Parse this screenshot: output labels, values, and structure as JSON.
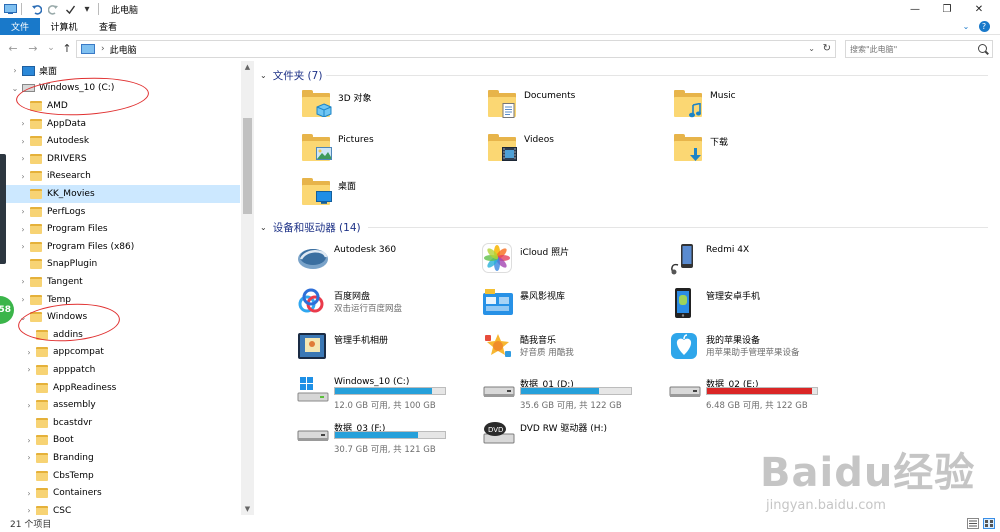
{
  "window": {
    "title": "此电脑",
    "quick_access_down": "▾",
    "minimize": "—",
    "maximize": "❐",
    "close": "✕"
  },
  "ribbon": {
    "tabs": [
      "文件",
      "计算机",
      "查看"
    ],
    "help_icon": "?"
  },
  "nav": {
    "back": "←",
    "forward": "→",
    "recent": "⌄",
    "up": "↑",
    "address": "此电脑",
    "address_chevron": "›",
    "search_placeholder": "搜索\"此电脑\""
  },
  "tree": [
    {
      "label": "桌面",
      "level": 0,
      "expander": "›",
      "icon": "desktop-icon"
    },
    {
      "label": "Windows_10 (C:)",
      "level": 0,
      "expander": "⌄",
      "icon": "drive-icon"
    },
    {
      "label": "AMD",
      "level": 1,
      "expander": ""
    },
    {
      "label": "AppData",
      "level": 1,
      "expander": "›"
    },
    {
      "label": "Autodesk",
      "level": 1,
      "expander": "›"
    },
    {
      "label": "DRIVERS",
      "level": 1,
      "expander": "›"
    },
    {
      "label": "iResearch",
      "level": 1,
      "expander": "›"
    },
    {
      "label": "KK_Movies",
      "level": 1,
      "expander": "",
      "selected": true
    },
    {
      "label": "PerfLogs",
      "level": 1,
      "expander": "›"
    },
    {
      "label": "Program Files",
      "level": 1,
      "expander": "›"
    },
    {
      "label": "Program Files (x86)",
      "level": 1,
      "expander": "›"
    },
    {
      "label": "SnapPlugin",
      "level": 1,
      "expander": ""
    },
    {
      "label": "Tangent",
      "level": 1,
      "expander": "›"
    },
    {
      "label": "Temp",
      "level": 1,
      "expander": "›"
    },
    {
      "label": "Windows",
      "level": 1,
      "expander": "⌄"
    },
    {
      "label": "addins",
      "level": 2,
      "expander": ""
    },
    {
      "label": "appcompat",
      "level": 2,
      "expander": "›"
    },
    {
      "label": "apppatch",
      "level": 2,
      "expander": "›"
    },
    {
      "label": "AppReadiness",
      "level": 2,
      "expander": ""
    },
    {
      "label": "assembly",
      "level": 2,
      "expander": "›"
    },
    {
      "label": "bcastdvr",
      "level": 2,
      "expander": ""
    },
    {
      "label": "Boot",
      "level": 2,
      "expander": "›"
    },
    {
      "label": "Branding",
      "level": 2,
      "expander": "›"
    },
    {
      "label": "CbsTemp",
      "level": 2,
      "expander": ""
    },
    {
      "label": "Containers",
      "level": 2,
      "expander": "›"
    },
    {
      "label": "CSC",
      "level": 2,
      "expander": "›"
    }
  ],
  "groups": {
    "folders_header": "文件夹 (7)",
    "devices_header": "设备和驱动器 (14)",
    "chevron": "⌄"
  },
  "folders": [
    {
      "name": "3D 对象",
      "icon": "3d-objects-icon"
    },
    {
      "name": "Documents",
      "icon": "documents-icon"
    },
    {
      "name": "Music",
      "icon": "music-icon"
    },
    {
      "name": "Pictures",
      "icon": "pictures-icon"
    },
    {
      "name": "Videos",
      "icon": "videos-icon"
    },
    {
      "name": "下载",
      "icon": "downloads-icon"
    },
    {
      "name": "桌面",
      "icon": "desktop-folder-icon"
    }
  ],
  "devices": [
    {
      "name": "Autodesk 360",
      "sub": "",
      "icon": "autodesk360-icon"
    },
    {
      "name": "iCloud 照片",
      "sub": "",
      "icon": "icloud-photos-icon"
    },
    {
      "name": "Redmi 4X",
      "sub": "",
      "icon": "phone-icon"
    },
    {
      "name": "百度网盘",
      "sub": "双击运行百度网盘",
      "icon": "baidu-netdisk-icon"
    },
    {
      "name": "暴风影视库",
      "sub": "",
      "icon": "baofeng-icon"
    },
    {
      "name": "管理安卓手机",
      "sub": "",
      "icon": "android-manager-icon"
    },
    {
      "name": "管理手机相册",
      "sub": "",
      "icon": "phone-album-icon"
    },
    {
      "name": "酷我音乐",
      "sub": "好音质 用酷我",
      "icon": "kuwo-icon"
    },
    {
      "name": "我的苹果设备",
      "sub": "用苹果助手管理苹果设备",
      "icon": "apple-device-icon"
    }
  ],
  "drives": [
    {
      "name": "Windows_10 (C:)",
      "sub": "12.0 GB 可用, 共 100 GB",
      "used_fraction": 0.88,
      "color": "#26a0da",
      "icon": "windows-drive-icon"
    },
    {
      "name": "数据_01 (D:)",
      "sub": "35.6 GB 可用, 共 122 GB",
      "used_fraction": 0.71,
      "color": "#26a0da",
      "icon": "hdd-icon"
    },
    {
      "name": "数据_02 (E:)",
      "sub": "6.48 GB 可用, 共 122 GB",
      "used_fraction": 0.95,
      "color": "#da2626",
      "icon": "hdd-icon"
    },
    {
      "name": "数据_03 (F:)",
      "sub": "30.7 GB 可用, 共 121 GB",
      "used_fraction": 0.75,
      "color": "#26a0da",
      "icon": "hdd-icon"
    },
    {
      "name": "DVD RW 驱动器 (H:)",
      "sub": "",
      "used_fraction": null,
      "icon": "dvd-icon"
    }
  ],
  "status": {
    "text": "21 个项目"
  },
  "annotations": {
    "side_badge": "58"
  },
  "watermark": {
    "main": "Baidu经验",
    "sub": "jingyan.baidu.com"
  }
}
